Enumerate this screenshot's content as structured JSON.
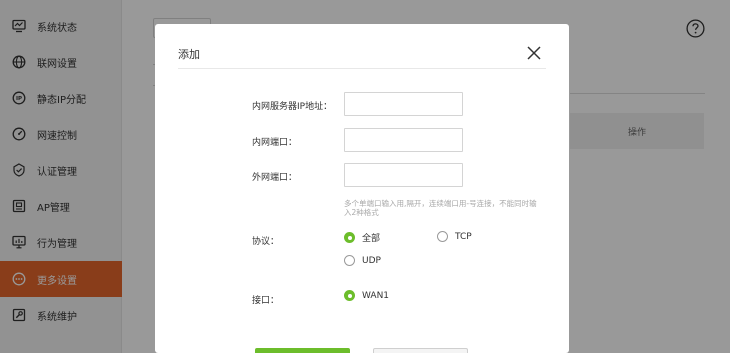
{
  "sidebar": {
    "items": [
      {
        "label": "系统状态",
        "icon": "monitor-icon"
      },
      {
        "label": "联网设置",
        "icon": "globe-icon"
      },
      {
        "label": "静态IP分配",
        "icon": "ip-icon"
      },
      {
        "label": "网速控制",
        "icon": "speedometer-icon"
      },
      {
        "label": "认证管理",
        "icon": "shield-check-icon"
      },
      {
        "label": "AP管理",
        "icon": "access-point-icon"
      },
      {
        "label": "行为管理",
        "icon": "chart-icon"
      },
      {
        "label": "更多设置",
        "icon": "more-icon",
        "active": true
      },
      {
        "label": "系统维护",
        "icon": "wrench-icon"
      }
    ]
  },
  "main": {
    "table_header_action": "操作"
  },
  "modal": {
    "title": "添加",
    "fields": {
      "inner_ip_label": "内网服务器IP地址：",
      "inner_ip_value": "",
      "inner_port_label": "内网端口：",
      "inner_port_value": "",
      "outer_port_label": "外网端口：",
      "outer_port_value": ""
    },
    "hint": "多个单端口输入用,隔开，连续端口用-号连接，不能同时输入2种格式",
    "protocol": {
      "label": "协议：",
      "options": [
        "全部",
        "TCP",
        "UDP"
      ],
      "selected": "全部"
    },
    "interface": {
      "label": "接口：",
      "options": [
        "WAN1"
      ],
      "selected": "WAN1"
    }
  },
  "colors": {
    "accent": "#e5672c",
    "confirm_green": "#6cbd2b"
  }
}
